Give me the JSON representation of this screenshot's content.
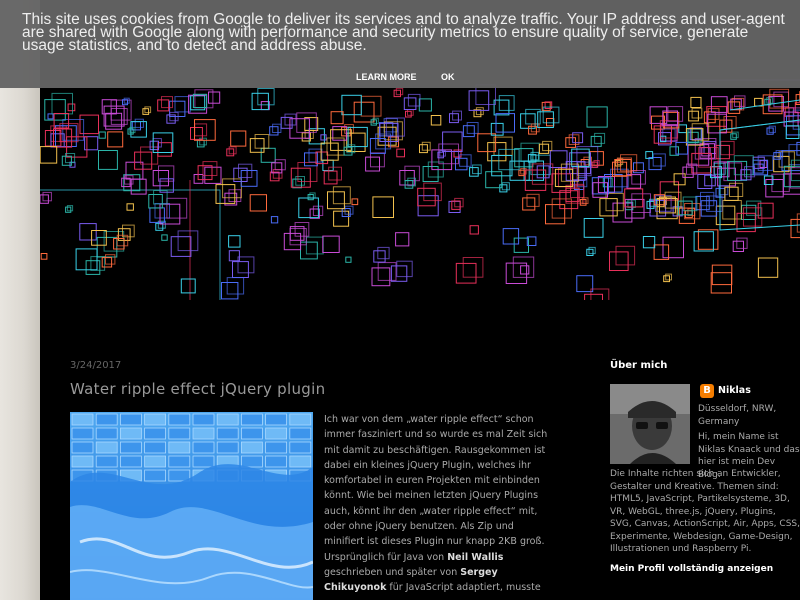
{
  "cookie": {
    "message": "This site uses cookies from Google to deliver its services and to analyze traffic. Your IP address and user-agent are shared with Google along with performance and security metrics to ensure quality of service, generate usage statistics, and to detect and address abuse.",
    "learn_more_label": "LEARN MORE",
    "ok_label": "OK"
  },
  "post": {
    "date": "3/24/2017",
    "title": "Water ripple effect jQuery plugin",
    "body_1": "Ich war von dem „water ripple effect“ schon immer fasziniert und so wurde es mal Zeit sich mit damit zu beschäftigen. Rausgekommen ist dabei ein kleines jQuery Plugin, welches ihr komfortabel in euren Projekten mit einbinden könnt. Wie bei meinen letzten jQuery Plugins auch, könnt ihr den „water ripple effect“ mit, oder ohne jQuery benutzen. Als Zip und minifiert ist dieses Plugin nur knapp 2KB groß. Ursprünglich für Java von ",
    "author_1": "Neil Wallis",
    "body_2": " geschrieben und später von ",
    "author_2": "Sergey Chikuyonok",
    "body_3": " für JavaScript adaptiert, musste"
  },
  "sidebar": {
    "title": "Über mich",
    "blogger_icon_glyph": "B",
    "name": "Niklas",
    "location": "Düsseldorf, NRW, Germany",
    "intro": "Hi, mein Name ist Niklas Knaack und das hier ist mein Dev Blog.",
    "description": "Die Inhalte richten sich an Entwickler, Gestalter und Kreative. Themen sind: HTML5, JavaScript, Partikelsysteme, 3D, VR, WebGL, three.js, jQuery, Plugins, SVG, Canvas, ActionScript, Air, Apps, CSS, Experimente, Webdesign, Game-Design, Illustrationen und Raspberry Pi.",
    "profile_link": "Mein Profil vollständig anzeigen"
  },
  "colors": {
    "page_background": "#000000",
    "banner_background": "#646464",
    "accent_orange": "#f57d00"
  }
}
